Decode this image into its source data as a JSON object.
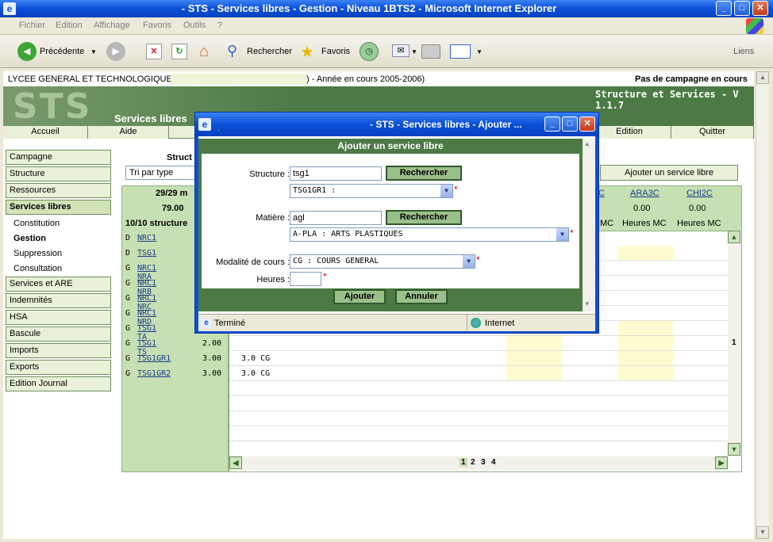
{
  "window": {
    "title": "- STS - Services libres - Gestion - Niveau 1BTS2 - Microsoft Internet Explorer",
    "min": "_",
    "max": "□",
    "close": "✕"
  },
  "menu": [
    "Fichier",
    "Edition",
    "Affichage",
    "Favoris",
    "Outils",
    "?"
  ],
  "toolbar": {
    "back": "Précédente",
    "search": "Rechercher",
    "favorites": "Favoris",
    "links": "Liens"
  },
  "header": {
    "school": "LYCEE GENERAL ET TECHNOLOGIQUE",
    "year": ") - Année en cours 2005-2006)",
    "campaign": "Pas de campagne en cours",
    "app_title": "Structure et Services - V 1.1.7",
    "logo": "STS",
    "section": "Services libres"
  },
  "nav": {
    "accueil": "Accueil",
    "aide": "Aide",
    "edition": "Edition",
    "quitter": "Quitter"
  },
  "sidebar": {
    "items": [
      "Campagne",
      "Structure",
      "Ressources",
      "Services libres",
      "Services et ARE",
      "Indemnités",
      "HSA",
      "Bascule",
      "Imports",
      "Exports",
      "Edition Journal"
    ],
    "sub": [
      "Constitution",
      "Gestion",
      "Suppression",
      "Consultation"
    ]
  },
  "main": {
    "struct_label": "Struct",
    "sort_select": "Tri par type",
    "add_button": "Ajouter un service libre",
    "count_line": "29/29 m",
    "total": "79.00",
    "struct_count": "10/10 structure",
    "columns": [
      {
        "name": "C",
        "value": "",
        "sub": "MC"
      },
      {
        "name": "ARA3C",
        "value": "0.00",
        "sub": "Heures MC"
      },
      {
        "name": "CHI2C",
        "value": "0.00",
        "sub": "Heures MC"
      }
    ],
    "rows": [
      {
        "type": "D",
        "name": "NRC1",
        "value": "",
        "cell": ""
      },
      {
        "type": "D",
        "name": "TSG1",
        "value": "",
        "cell": ""
      },
      {
        "type": "G",
        "name": "NRC1 NRA",
        "value": "",
        "cell": ""
      },
      {
        "type": "G",
        "name": "NRC1 NRB",
        "value": "",
        "cell": ""
      },
      {
        "type": "G",
        "name": "NRC1 NRC",
        "value": "",
        "cell": ""
      },
      {
        "type": "G",
        "name": "NRC1 NRD",
        "value": "",
        "cell": ""
      },
      {
        "type": "G",
        "name": "TSG1 TA",
        "value": "",
        "cell": ""
      },
      {
        "type": "G",
        "name": "TSG1 TS",
        "value": "2.00",
        "cell": ""
      },
      {
        "type": "G",
        "name": "TSG1GR1",
        "value": "3.00",
        "cell": "3.0 CG"
      },
      {
        "type": "G",
        "name": "TSG1GR2",
        "value": "3.00",
        "cell": "3.0 CG"
      }
    ],
    "pages": [
      "1",
      "2",
      "3",
      "4"
    ],
    "scroll_marker": "1"
  },
  "popup": {
    "title": "- STS - Services libres - Ajouter ...",
    "heading": "Ajouter un service libre",
    "structure_label": "Structure :",
    "structure_value": "tsg1",
    "structure_select": "TSG1GR1 :",
    "search_btn": "Rechercher",
    "matiere_label": "Matière :",
    "matiere_value": "agl",
    "matiere_select": "A-PLA : ARTS PLASTIQUES",
    "modalite_label": "Modalité de cours :",
    "modalite_select": "CG : COURS GENERAL",
    "heures_label": "Heures :",
    "heures_value": "",
    "add": "Ajouter",
    "cancel": "Annuler",
    "status": "Terminé",
    "zone": "Internet"
  }
}
